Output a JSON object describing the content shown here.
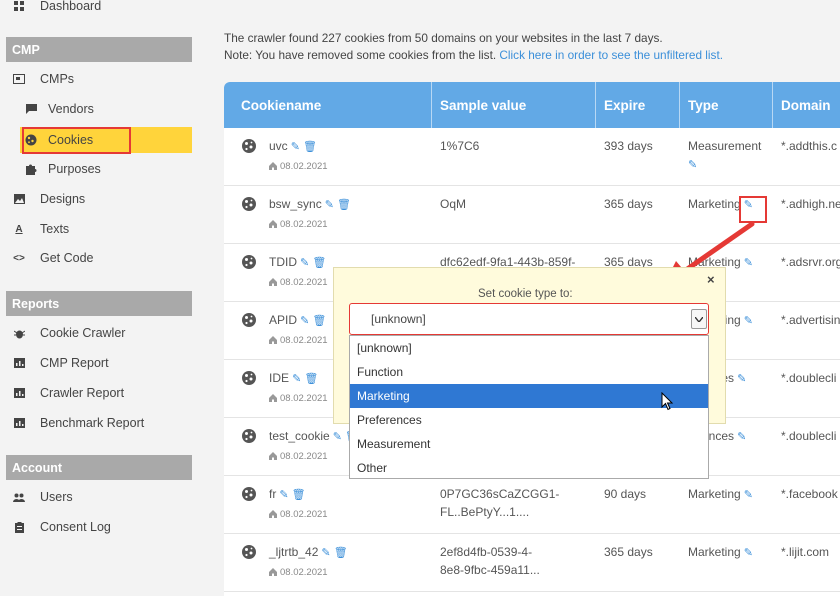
{
  "sidebar": {
    "dashboard": "Dashboard",
    "sections": {
      "cmp": "CMP",
      "reports": "Reports",
      "account": "Account"
    },
    "cmp_items": {
      "cmps": "CMPs",
      "vendors": "Vendors",
      "cookies": "Cookies",
      "purposes": "Purposes",
      "designs": "Designs",
      "texts": "Texts",
      "get_code": "Get Code"
    },
    "report_items": {
      "cookie_crawler": "Cookie Crawler",
      "cmp_report": "CMP Report",
      "crawler_report": "Crawler Report",
      "benchmark_report": "Benchmark Report"
    },
    "account_items": {
      "users": "Users",
      "consent_log": "Consent Log"
    },
    "active_color": "#ffd43b"
  },
  "main": {
    "info_line1": "The crawler found 227 cookies from 50 domains on your websites in the last 7 days.",
    "info_line2_prefix": "Note: You have removed some cookies from the list.",
    "info_line2_link": "Click here in order to see the unfiltered list."
  },
  "table": {
    "header_color": "#62a9e6",
    "columns": {
      "cookiename": "Cookiename",
      "sample": "Sample value",
      "expire": "Expire",
      "type": "Type",
      "domain": "Domain"
    },
    "rows": [
      {
        "name": "uvc",
        "date": "08.02.2021",
        "sample1": "1%7C6",
        "sample2": "",
        "expire": "393 days",
        "type": "Measurement",
        "domain": "*.addthis.c"
      },
      {
        "name": "bsw_sync",
        "date": "08.02.2021",
        "sample1": "OqM",
        "sample2": "",
        "expire": "365 days",
        "type": "Marketing",
        "domain": "*.adhigh.ne"
      },
      {
        "name": "TDID",
        "date": "08.02.2021",
        "sample1": "dfc62edf-9fa1-443b-859f-",
        "sample2": "",
        "expire": "365 days",
        "type": "Marketing",
        "domain": "*.adsrvr.org"
      },
      {
        "name": "APID",
        "date": "08.02.2021",
        "sample1": "",
        "sample2": "",
        "expire": "",
        "type": "Marketing",
        "domain": "*.advertisin"
      },
      {
        "name": "IDE",
        "date": "08.02.2021",
        "sample1": "",
        "sample2": "",
        "expire": "",
        "type": "ferences",
        "domain": "*.doublecli"
      },
      {
        "name": "test_cookie",
        "date": "08.02.2021",
        "sample1": "",
        "sample2": "",
        "expire": "",
        "type": "ferences",
        "domain": "*.doublecli"
      },
      {
        "name": "fr",
        "date": "08.02.2021",
        "sample1": "0P7GC36sCaZCGG1-",
        "sample2": "FL..BePtyY...1....",
        "expire": "90 days",
        "type": "Marketing",
        "domain": "*.facebook"
      },
      {
        "name": "_ljtrtb_42",
        "date": "08.02.2021",
        "sample1": "2ef8d4fb-0539-4-",
        "sample2": "8e8-9fbc-459a11...",
        "expire": "365 days",
        "type": "Marketing",
        "domain": "*.lijit.com"
      }
    ]
  },
  "popup": {
    "close": "×",
    "label": "Set cookie type to:",
    "selected_value": "[unknown]",
    "options": [
      "[unknown]",
      "Function",
      "Marketing",
      "Preferences",
      "Measurement",
      "Other"
    ],
    "highlighted_option": "Marketing"
  },
  "annotation_color": "#e53935"
}
